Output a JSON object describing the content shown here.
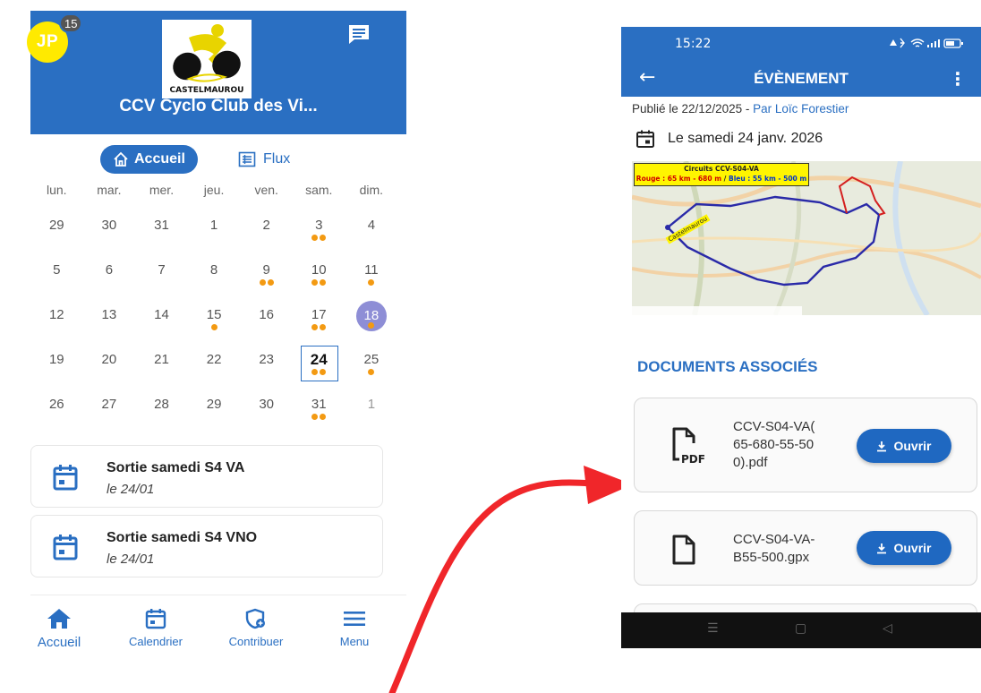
{
  "left": {
    "avatar": {
      "initials": "JP",
      "badge": "15"
    },
    "logo": {
      "text": "CASTELMAUROU"
    },
    "club_title": "CCV Cyclo Club des Vi...",
    "tabs": {
      "home": "Accueil",
      "flux": "Flux"
    },
    "weekdays": [
      "lun.",
      "mar.",
      "mer.",
      "jeu.",
      "ven.",
      "sam.",
      "dim."
    ],
    "calendar": [
      [
        {
          "d": "29",
          "dots": 0,
          "dim": false
        },
        {
          "d": "30",
          "dots": 0
        },
        {
          "d": "31",
          "dots": 0
        },
        {
          "d": "1",
          "dots": 0
        },
        {
          "d": "2",
          "dots": 0
        },
        {
          "d": "3",
          "dots": 2
        },
        {
          "d": "4",
          "dots": 0
        }
      ],
      [
        {
          "d": "5",
          "dots": 0
        },
        {
          "d": "6",
          "dots": 0
        },
        {
          "d": "7",
          "dots": 0
        },
        {
          "d": "8",
          "dots": 0
        },
        {
          "d": "9",
          "dots": 2
        },
        {
          "d": "10",
          "dots": 2
        },
        {
          "d": "11",
          "dots": 1
        }
      ],
      [
        {
          "d": "12",
          "dots": 0
        },
        {
          "d": "13",
          "dots": 0
        },
        {
          "d": "14",
          "dots": 0
        },
        {
          "d": "15",
          "dots": 1
        },
        {
          "d": "16",
          "dots": 0
        },
        {
          "d": "17",
          "dots": 2
        },
        {
          "d": "18",
          "dots": 1,
          "today": true
        }
      ],
      [
        {
          "d": "19",
          "dots": 0
        },
        {
          "d": "20",
          "dots": 0
        },
        {
          "d": "21",
          "dots": 0
        },
        {
          "d": "22",
          "dots": 0
        },
        {
          "d": "23",
          "dots": 0
        },
        {
          "d": "24",
          "dots": 2,
          "selected": true
        },
        {
          "d": "25",
          "dots": 1
        }
      ],
      [
        {
          "d": "26",
          "dots": 0
        },
        {
          "d": "27",
          "dots": 0
        },
        {
          "d": "28",
          "dots": 0
        },
        {
          "d": "29",
          "dots": 0
        },
        {
          "d": "30",
          "dots": 0
        },
        {
          "d": "31",
          "dots": 2
        },
        {
          "d": "1",
          "dots": 0,
          "dim": true
        }
      ]
    ],
    "events": [
      {
        "title": "Sortie samedi S4 VA",
        "date": "le 24/01"
      },
      {
        "title": "Sortie samedi S4 VNO",
        "date": "le 24/01"
      }
    ],
    "bottom_nav": {
      "home": "Accueil",
      "calendar": "Calendrier",
      "contribute": "Contribuer",
      "menu": "Menu"
    },
    "colors": {
      "primary": "#2a6fc2",
      "dot": "#f39a12",
      "today": "#8e8ed6"
    }
  },
  "right": {
    "status": {
      "time": "15:22"
    },
    "appbar": {
      "title": "ÉVÈNEMENT"
    },
    "published": {
      "prefix": "Publié le 22/12/2025 -",
      "author": "Par Loïc Forestier"
    },
    "event_date": "Le samedi 24 janv. 2026",
    "map": {
      "title": "Circuits CCV-S04-VA",
      "red": "Rouge : 65 km - 680 m",
      "sep": " / ",
      "blue": "Bleu : 55 km - 500 m",
      "town": "Castelmaurou"
    },
    "section_title": "DOCUMENTS ASSOCIÉS",
    "documents": [
      {
        "name_lines": [
          "CCV-S04-VA(",
          "65-680-55-50",
          "0).pdf"
        ],
        "type": "pdf",
        "button": "Ouvrir"
      },
      {
        "name_lines": [
          "CCV-S04-VA-",
          "B55-500.gpx"
        ],
        "type": "file",
        "button": "Ouvrir"
      }
    ],
    "colors": {
      "primary": "#2a6fc2",
      "button": "#1f68c1"
    }
  }
}
